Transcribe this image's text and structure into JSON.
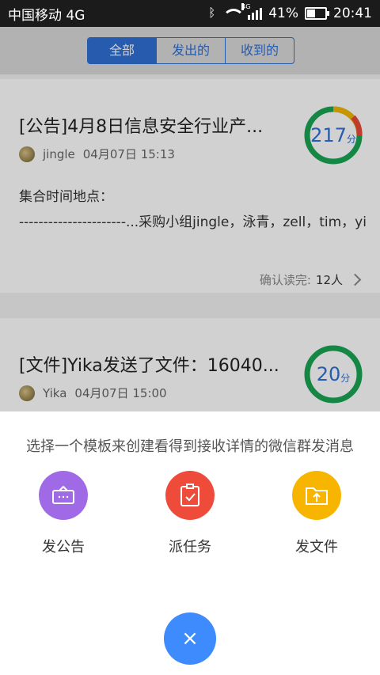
{
  "statusbar": {
    "carrier": "中国移动 4G",
    "net_tag": "4G",
    "battery": "41%",
    "time": "20:41",
    "icons": [
      "bluetooth-icon",
      "wifi-icon",
      "signal-icon",
      "battery-icon"
    ]
  },
  "tabs": [
    "全部",
    "发出的",
    "收到的"
  ],
  "cards": [
    {
      "title": "[公告]4月8日信息安全行业产...",
      "user": "jingle",
      "date": "04月07日 15:13",
      "score": "217",
      "score_unit": "分",
      "body_line1": "集合时间地点：",
      "body_line2": "----------------------...采购小组jingle，泳青，zell，tim，yi",
      "confirm_label": "确认读完:",
      "confirm_value": "12人"
    },
    {
      "title": "[文件]Yika发送了文件：16040...",
      "user": "Yika",
      "date": "04月07日 15:00",
      "score": "20",
      "score_unit": "分"
    }
  ],
  "sheet": {
    "hint": "选择一个模板来创建看得到接收详情的微信群发消息",
    "options": [
      {
        "label": "发公告",
        "color": "#a06ae6",
        "icon": "announcement-icon"
      },
      {
        "label": "派任务",
        "color": "#ee4b3a",
        "icon": "task-icon"
      },
      {
        "label": "发文件",
        "color": "#f7b500",
        "icon": "file-upload-icon"
      }
    ],
    "close_label": "×"
  },
  "colors": {
    "accent": "#2f6fd4",
    "ring_green": "#1aa555",
    "ring_yellow": "#f2b600",
    "ring_red": "#e84a3a"
  }
}
